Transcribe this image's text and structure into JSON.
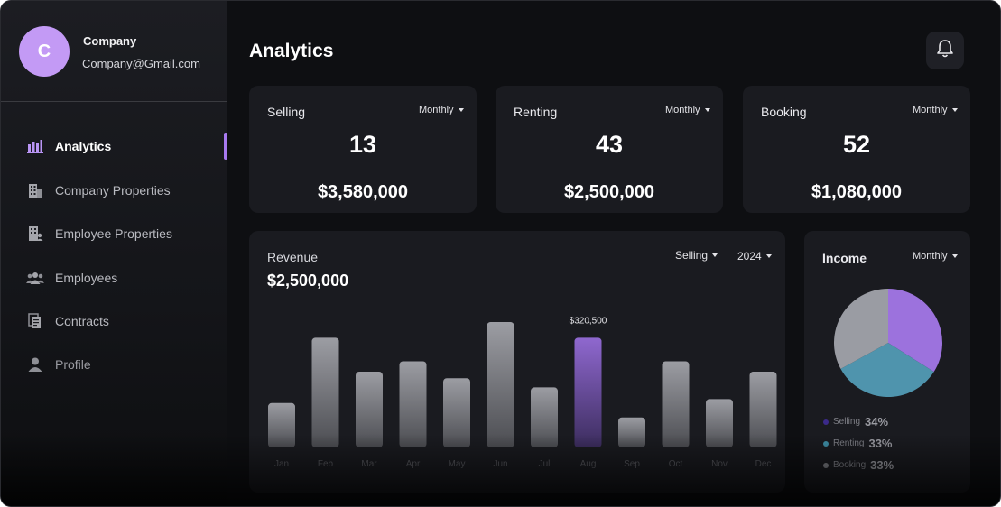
{
  "user": {
    "avatar_letter": "C",
    "name": "Company",
    "email": "Company@Gmail.com"
  },
  "sidebar": {
    "items": [
      {
        "label": "Analytics",
        "icon": "bar-chart-icon",
        "active": true
      },
      {
        "label": "Company Properties",
        "icon": "building-icon",
        "active": false
      },
      {
        "label": "Employee Properties",
        "icon": "employee-building-icon",
        "active": false
      },
      {
        "label": "Employees",
        "icon": "people-icon",
        "active": false
      },
      {
        "label": "Contracts",
        "icon": "documents-icon",
        "active": false
      },
      {
        "label": "Profile",
        "icon": "user-icon",
        "active": false
      }
    ]
  },
  "header": {
    "title": "Analytics",
    "notification_icon": "bell-icon"
  },
  "stats": [
    {
      "title": "Selling",
      "period": "Monthly",
      "count": "13",
      "amount": "$3,580,000"
    },
    {
      "title": "Renting",
      "period": "Monthly",
      "count": "43",
      "amount": "$2,500,000"
    },
    {
      "title": "Booking",
      "period": "Monthly",
      "count": "52",
      "amount": "$1,080,000"
    }
  ],
  "revenue": {
    "title": "Revenue",
    "amount": "$2,500,000",
    "type_filter": "Selling",
    "year_filter": "2024",
    "highlight_label": "$320,500"
  },
  "income": {
    "title": "Income",
    "period": "Monthly",
    "legend": [
      {
        "name": "Selling",
        "pct": "34%",
        "color": "#3b2a8a"
      },
      {
        "name": "Renting",
        "pct": "33%",
        "color": "#3e8ea6"
      },
      {
        "name": "Booking",
        "pct": "33%",
        "color": "#7d7e84"
      }
    ]
  },
  "colors": {
    "accent": "#a779f0",
    "card": "#1a1b20",
    "background": "#0e0f12"
  },
  "chart_data": [
    {
      "type": "bar",
      "title": "",
      "categories": [
        "Jan",
        "Feb",
        "Mar",
        "Apr",
        "May",
        "Jun",
        "Jul",
        "Aug",
        "Sep",
        "Oct",
        "Nov",
        "Dec"
      ],
      "values": [
        170000,
        420000,
        290000,
        330000,
        265000,
        480000,
        230000,
        420000,
        115000,
        330000,
        185000,
        290000
      ],
      "highlight_index": 7,
      "ylim": [
        0,
        480000
      ],
      "grid": false,
      "xlabel": "",
      "ylabel": ""
    },
    {
      "type": "pie",
      "title": "",
      "labels": [
        "Selling",
        "Renting",
        "Booking"
      ],
      "values": [
        34,
        33,
        33
      ],
      "colors": [
        "#9c72dd",
        "#4f94ad",
        "#9a9ca3"
      ]
    }
  ]
}
